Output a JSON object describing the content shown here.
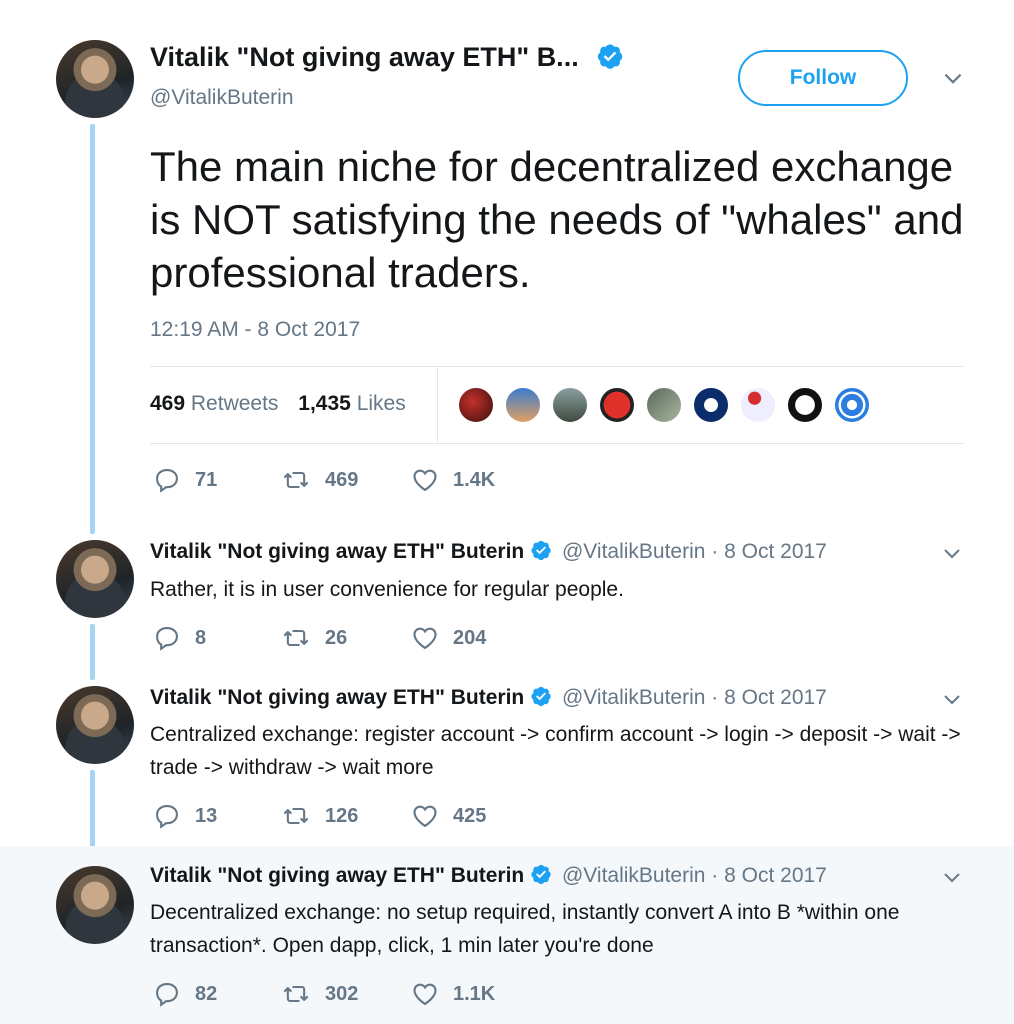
{
  "main_tweet": {
    "display_name": "Vitalik \"Not giving away ETH\" B...",
    "handle": "@VitalikButerin",
    "follow_label": "Follow",
    "text": "The main niche for decentralized exchange is NOT satisfying the needs of \"whales\" and professional traders.",
    "timestamp": "12:19 AM - 8 Oct 2017",
    "retweets_count": "469",
    "retweets_label": "Retweets",
    "likes_count": "1,435",
    "likes_label": "Likes",
    "replies": "71",
    "retweets": "469",
    "likes": "1.4K"
  },
  "replies": [
    {
      "name": "Vitalik \"Not giving away ETH\" Buterin",
      "handle": "@VitalikButerin",
      "date": "· 8 Oct 2017",
      "text": "Rather, it is in user convenience for regular people.",
      "replies": "8",
      "retweets": "26",
      "likes": "204"
    },
    {
      "name": "Vitalik \"Not giving away ETH\" Buterin",
      "handle": "@VitalikButerin",
      "date": "· 8 Oct 2017",
      "text": "Centralized exchange: register account -> confirm account -> login -> deposit -> wait -> trade -> withdraw -> wait more",
      "replies": "13",
      "retweets": "126",
      "likes": "425"
    },
    {
      "name": "Vitalik \"Not giving away ETH\" Buterin",
      "handle": "@VitalikButerin",
      "date": "· 8 Oct 2017",
      "text": "Decentralized exchange: no setup required, instantly convert A into B *within one transaction*. Open dapp, click, 1 min later you're done",
      "replies": "82",
      "retweets": "302",
      "likes": "1.1K"
    }
  ],
  "colors": {
    "accent": "#1da1f2",
    "muted": "#657786",
    "thread_line": "#a6d4f2",
    "highlight_bg": "#f5f8fa"
  }
}
